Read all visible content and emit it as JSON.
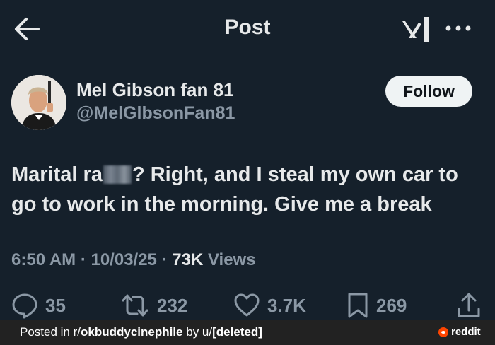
{
  "header": {
    "title": "Post",
    "back_icon": "back-arrow-icon",
    "brand_icon": "xai-logo-icon",
    "more_icon": "more-options-icon"
  },
  "author": {
    "name": "Mel Gibson fan 81",
    "handle": "@MelGlbsonFan81",
    "follow_label": "Follow"
  },
  "post": {
    "text_before": "Marital ra",
    "text_after": "? Right, and I steal my own car to go to work in the morning. Give me a break"
  },
  "meta": {
    "time": "6:50 AM",
    "sep1": "·",
    "date": "10/03/25",
    "sep2": "·",
    "views_count": "73K",
    "views_label": "Views"
  },
  "actions": {
    "replies": "35",
    "reposts": "232",
    "likes": "3.7K",
    "bookmarks": "269"
  },
  "footer": {
    "posted_in": "Posted in r/",
    "subreddit": "okbuddycinephile",
    "by": " by u/",
    "user": "[deleted]",
    "brand": "reddit"
  },
  "colors": {
    "background": "#15202b",
    "text": "#e7e9ea",
    "muted": "#8b98a5",
    "reddit": "#ff4500"
  }
}
